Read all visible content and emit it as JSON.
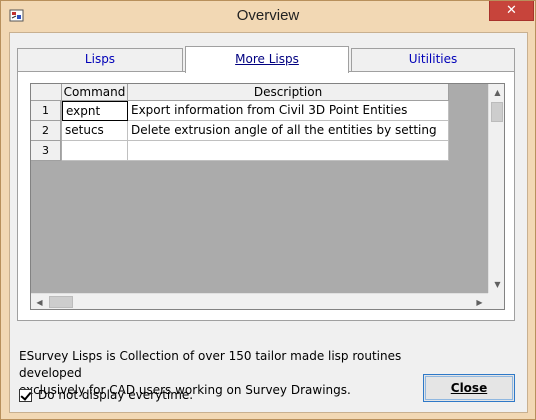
{
  "window": {
    "title": "Overview",
    "close_glyph": "✕"
  },
  "tabs": [
    {
      "label": "Lisps",
      "active": false
    },
    {
      "label": "More Lisps",
      "active": true
    },
    {
      "label": "Uitilities",
      "active": false
    }
  ],
  "grid": {
    "columns": [
      "Command",
      "Description"
    ],
    "rows": [
      {
        "num": "1",
        "command": "expnt",
        "description": "Export information from Civil 3D Point Entities"
      },
      {
        "num": "2",
        "command": "setucs",
        "description": "Delete extrusion angle of all the entities by setting"
      },
      {
        "num": "3",
        "command": "",
        "description": ""
      }
    ]
  },
  "footer": {
    "description_line1": "ESurvey Lisps is Collection of over 150 tailor made lisp routines developed",
    "description_line2": "exclusively for CAD users working on Survey Drawings.",
    "checkbox_label": "Do not display everytime.",
    "checkbox_checked": true,
    "close_label": "Close"
  },
  "colors": {
    "frame": "#f2d8b4",
    "close_red": "#c7443b",
    "tab_text": "#0000b8",
    "grid_bg": "#ababab"
  }
}
